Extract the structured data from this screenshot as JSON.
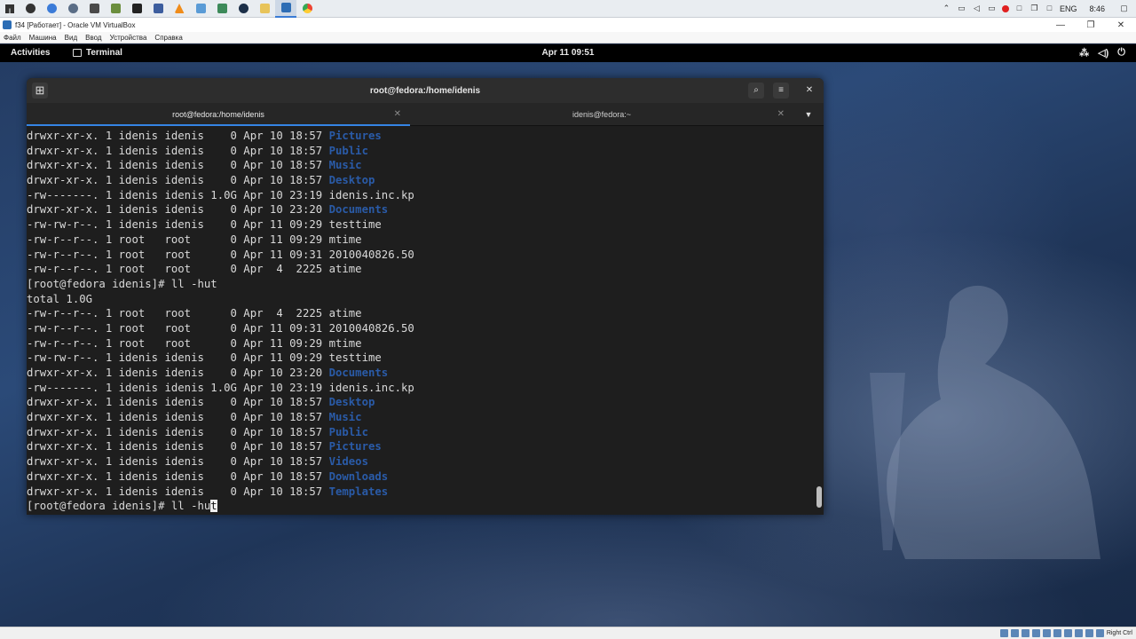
{
  "taskbar": {
    "apps": [
      "start-icon",
      "chrome-icon",
      "globe-icon",
      "folder-icon",
      "monitor-icon",
      "notepad-icon",
      "terminal-icon",
      "virtualbox-icon",
      "vlc-icon",
      "shield-icon",
      "tree-icon",
      "steam-icon",
      "explorer-icon",
      "vbox-manager-icon",
      "chrome2-icon"
    ],
    "lang": "ENG",
    "time": "8:46"
  },
  "vbox": {
    "title": "f34 [Работает] - Oracle VM VirtualBox",
    "menu": [
      "Файл",
      "Машина",
      "Вид",
      "Ввод",
      "Устройства",
      "Справка"
    ],
    "status_right": "Right Ctrl"
  },
  "gnome": {
    "activities": "Activities",
    "app_name": "Terminal",
    "clock": "Apr 11  09:51"
  },
  "terminal": {
    "title": "root@fedora:/home/idenis",
    "tabs": [
      {
        "label": "root@fedora:/home/idenis",
        "active": true
      },
      {
        "label": "idenis@fedora:~",
        "active": false
      }
    ],
    "lines": [
      {
        "text": "drwxr-xr-x. 1 idenis idenis    0 Apr 10 18:57 ",
        "name": "Pictures",
        "dir": true
      },
      {
        "text": "drwxr-xr-x. 1 idenis idenis    0 Apr 10 18:57 ",
        "name": "Public",
        "dir": true
      },
      {
        "text": "drwxr-xr-x. 1 idenis idenis    0 Apr 10 18:57 ",
        "name": "Music",
        "dir": true
      },
      {
        "text": "drwxr-xr-x. 1 idenis idenis    0 Apr 10 18:57 ",
        "name": "Desktop",
        "dir": true
      },
      {
        "text": "-rw-------. 1 idenis idenis 1.0G Apr 10 23:19 ",
        "name": "idenis.inc.kp",
        "dir": false
      },
      {
        "text": "drwxr-xr-x. 1 idenis idenis    0 Apr 10 23:20 ",
        "name": "Documents",
        "dir": true
      },
      {
        "text": "-rw-rw-r--. 1 idenis idenis    0 Apr 11 09:29 ",
        "name": "testtime",
        "dir": false
      },
      {
        "text": "-rw-r--r--. 1 root   root      0 Apr 11 09:29 ",
        "name": "mtime",
        "dir": false
      },
      {
        "text": "-rw-r--r--. 1 root   root      0 Apr 11 09:31 ",
        "name": "2010040826.50",
        "dir": false
      },
      {
        "text": "-rw-r--r--. 1 root   root      0 Apr  4  2225 ",
        "name": "atime",
        "dir": false
      },
      {
        "text": "[root@fedora idenis]# ll -hut",
        "name": "",
        "dir": false
      },
      {
        "text": "total 1.0G",
        "name": "",
        "dir": false
      },
      {
        "text": "-rw-r--r--. 1 root   root      0 Apr  4  2225 ",
        "name": "atime",
        "dir": false
      },
      {
        "text": "-rw-r--r--. 1 root   root      0 Apr 11 09:31 ",
        "name": "2010040826.50",
        "dir": false
      },
      {
        "text": "-rw-r--r--. 1 root   root      0 Apr 11 09:29 ",
        "name": "mtime",
        "dir": false
      },
      {
        "text": "-rw-rw-r--. 1 idenis idenis    0 Apr 11 09:29 ",
        "name": "testtime",
        "dir": false
      },
      {
        "text": "drwxr-xr-x. 1 idenis idenis    0 Apr 10 23:20 ",
        "name": "Documents",
        "dir": true
      },
      {
        "text": "-rw-------. 1 idenis idenis 1.0G Apr 10 23:19 ",
        "name": "idenis.inc.kp",
        "dir": false
      },
      {
        "text": "drwxr-xr-x. 1 idenis idenis    0 Apr 10 18:57 ",
        "name": "Desktop",
        "dir": true
      },
      {
        "text": "drwxr-xr-x. 1 idenis idenis    0 Apr 10 18:57 ",
        "name": "Music",
        "dir": true
      },
      {
        "text": "drwxr-xr-x. 1 idenis idenis    0 Apr 10 18:57 ",
        "name": "Public",
        "dir": true
      },
      {
        "text": "drwxr-xr-x. 1 idenis idenis    0 Apr 10 18:57 ",
        "name": "Pictures",
        "dir": true
      },
      {
        "text": "drwxr-xr-x. 1 idenis idenis    0 Apr 10 18:57 ",
        "name": "Videos",
        "dir": true
      },
      {
        "text": "drwxr-xr-x. 1 idenis idenis    0 Apr 10 18:57 ",
        "name": "Downloads",
        "dir": true
      },
      {
        "text": "drwxr-xr-x. 1 idenis idenis    0 Apr 10 18:57 ",
        "name": "Templates",
        "dir": true
      }
    ],
    "prompt": "[root@fedora idenis]# ll -hu",
    "cursor_char": "t"
  },
  "colors": {
    "dir": "#2a5ba8",
    "accent": "#3584e4"
  }
}
